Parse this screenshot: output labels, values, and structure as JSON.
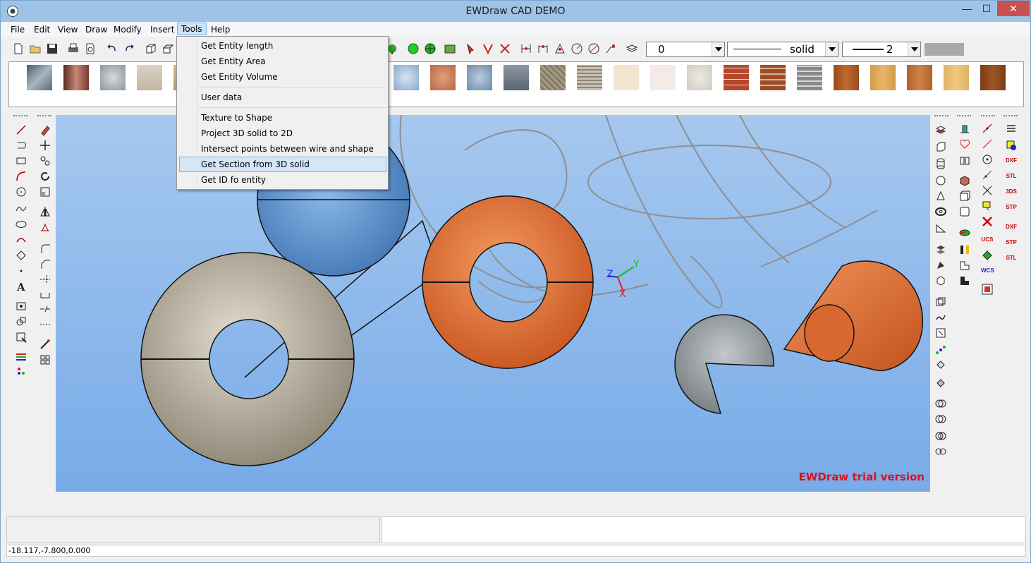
{
  "window": {
    "title": "EWDraw CAD DEMO",
    "controls": {
      "minimize": "—",
      "maximize": "☐",
      "close": "✕"
    }
  },
  "menubar": {
    "items": [
      "File",
      "Edit",
      "View",
      "Draw",
      "Modify",
      "Insert",
      "Tools",
      "Help"
    ],
    "active": "Tools"
  },
  "tools_menu": {
    "items": [
      {
        "label": "Get Entity length"
      },
      {
        "label": "Get Entity Area"
      },
      {
        "label": "Get Entity Volume"
      },
      {
        "label": "User data"
      },
      {
        "label": "Texture to Shape"
      },
      {
        "label": "Project 3D solid to 2D"
      },
      {
        "label": "Intersect points between wire and shape"
      },
      {
        "label": "Get Section from 3D solid",
        "highlighted": true
      },
      {
        "label": "Get ID fo entity"
      }
    ]
  },
  "toolbar": {
    "layer_value": "0",
    "linetype_value": "solid",
    "lineweight_value": "2",
    "color_swatch": "#a9a9a9"
  },
  "viewport": {
    "watermark": "EWDraw trial version",
    "axis_labels": {
      "x": "X",
      "y": "Y",
      "z": "Z"
    },
    "background_top": "#a6c8ef",
    "background_bottom": "#78abe8"
  },
  "statusbar": {
    "coordinates": "-18.117,-7.800,0.000"
  },
  "icons": {
    "textures": [
      "metal-texture",
      "copper-texture",
      "granite-texture",
      "sand-texture",
      "water-texture",
      "clay-texture",
      "slate-texture",
      "stone-texture",
      "burlap-texture",
      "bark-texture",
      "beige-texture",
      "marble-texture",
      "plaster-texture",
      "brick-texture",
      "brick-texture-2",
      "stonewall-texture",
      "wood-texture",
      "wood-texture-2",
      "wood-texture-3",
      "wood-texture-4",
      "wood-texture-5"
    ]
  }
}
